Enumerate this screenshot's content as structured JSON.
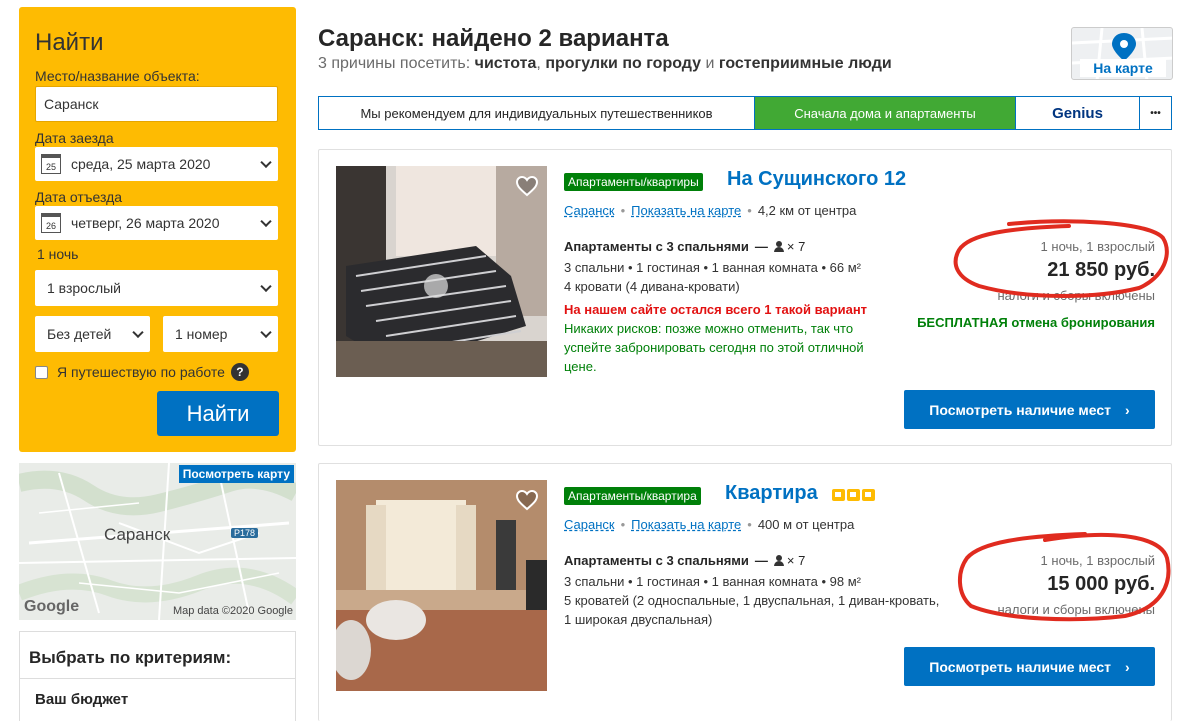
{
  "search": {
    "title": "Найти",
    "place_label": "Место/название объекта:",
    "place_value": "Саранск",
    "checkin_label": "Дата заезда",
    "checkin_day": "25",
    "checkin_value": "среда, 25 марта 2020",
    "checkout_label": "Дата отъезда",
    "checkout_day": "26",
    "checkout_value": "четверг, 26 марта 2020",
    "nights": "1 ночь",
    "adults": "1 взрослый",
    "children": "Без детей",
    "rooms": "1 номер",
    "business_label": "Я путешествую по работе",
    "help": "?",
    "button": "Найти"
  },
  "map": {
    "link": "Посмотреть карту",
    "city": "Саранск",
    "road": "P178",
    "google": "Google",
    "data": "Map data ©2020 Google"
  },
  "filters": {
    "title": "Выбрать по критериям:",
    "budget": "Ваш бюджет"
  },
  "header": {
    "title": "Саранск: найдено 2 варианта",
    "reasons_prefix": "3 причины посетить: ",
    "reason1": "чистота",
    "sep1": ", ",
    "reason2": "прогулки по городу",
    "sep2": " и ",
    "reason3": "гостеприимные люди",
    "on_map": "На карте"
  },
  "sort": {
    "tab1": "Мы рекомендуем для индивидуальных путешественников",
    "tab2": "Сначала дома и апартаменты",
    "tab3": "Genius",
    "more": "•••"
  },
  "properties": [
    {
      "type": "Апартаменты/квартиры",
      "name": "На Сущинского 12",
      "city": "Саранск",
      "show_map": "Показать на карте",
      "distance": "4,2 км от центра",
      "unit": "Апартаменты с 3 спальнями",
      "occupancy": "× 7",
      "rooms": "3 спальни • 1 гостиная • 1 ванная комната • 66 м²",
      "beds": "4 кровати (4 дивана-кровати)",
      "scarcity": "На нашем сайте остался всего 1 такой вариант",
      "norisk1": "Никаких рисков: позже можно отменить, так что",
      "norisk2": "успейте забронировать сегодня по этой отличной",
      "norisk3": "цене.",
      "price_meta": "1 ночь, 1 взрослый",
      "price": "21 850 руб.",
      "taxes": "налоги и сборы включены",
      "free_cancel": "БЕСПЛАТНАЯ отмена бронирования",
      "button": "Посмотреть наличие мест",
      "stars": 0
    },
    {
      "type": "Апартаменты/квартира",
      "name": "Квартира",
      "city": "Саранск",
      "show_map": "Показать на карте",
      "distance": "400 м от центра",
      "unit": "Апартаменты с 3 спальнями",
      "occupancy": "× 7",
      "rooms": "3 спальни • 1 гостиная • 1 ванная комната • 98 м²",
      "beds": "5 кроватей (2 односпальные, 1 двуспальная, 1 диван-кровать,",
      "beds2": "1 широкая двуспальная)",
      "price_meta": "1 ночь, 1 взрослый",
      "price": "15 000 руб.",
      "taxes": "налоги и сборы включены",
      "button": "Посмотреть наличие мест",
      "stars": 3
    }
  ],
  "colors": {
    "brand_blue": "#0071c2",
    "search_yellow": "#febb02",
    "green": "#008009",
    "sort_green": "#41a934",
    "scarcity_red": "#e21111",
    "annotation_red": "#e02b1f"
  }
}
